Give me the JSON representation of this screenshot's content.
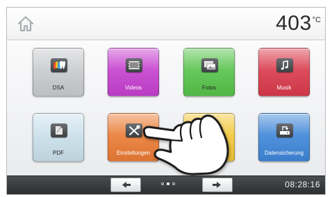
{
  "header": {
    "home_icon": "home-icon",
    "temperature": "403",
    "temperature_unit": "°C"
  },
  "tiles": [
    {
      "label": "DSA",
      "icon": "tooth-color-icon",
      "color": "#c8cacc"
    },
    {
      "label": "Videos",
      "icon": "film-icon",
      "color": "#c53fce"
    },
    {
      "label": "Fotos",
      "icon": "photos-icon",
      "color": "#56c24a"
    },
    {
      "label": "Musik",
      "icon": "music-note-icon",
      "color": "#d9394b"
    },
    {
      "label": "PDF",
      "icon": "document-icon",
      "color": "#c9dfea"
    },
    {
      "label": "Einstellungen",
      "icon": "wrench-screwdriver-icon",
      "color": "#ea7b34"
    },
    {
      "label": "",
      "icon": "music-note-icon",
      "color": "#f2c737"
    },
    {
      "label": "Datensicherung",
      "icon": "backup-drive-icon",
      "color": "#3e86d8"
    }
  ],
  "footer": {
    "back_icon": "arrow-left-icon",
    "forward_icon": "arrow-right-icon",
    "page_dots": 3,
    "active_page": 2,
    "clock": "08:28:16"
  },
  "overlay": {
    "icon": "pointing-hand-icon"
  }
}
